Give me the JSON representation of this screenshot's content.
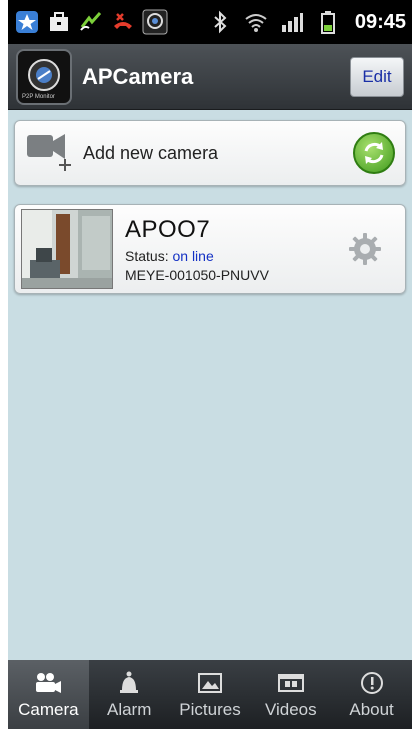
{
  "status_bar": {
    "time": "09:45",
    "icons": [
      "app-badge-icon",
      "briefcase-icon",
      "missed-call-icon",
      "call-end-icon",
      "camera-app-icon",
      "bluetooth-icon",
      "wifi-icon",
      "signal-icon",
      "battery-icon"
    ]
  },
  "header": {
    "title": "APCamera",
    "edit_label": "Edit",
    "logo_caption": "P2P Monitor"
  },
  "add_camera": {
    "label": "Add new camera"
  },
  "cameras": [
    {
      "name": "APOO7",
      "status_label": "Status:",
      "status_value": "on line",
      "device_id": "MEYE-001050-PNUVV"
    }
  ],
  "tabs": [
    {
      "label": "Camera",
      "icon": "camera-tab-icon",
      "active": true
    },
    {
      "label": "Alarm",
      "icon": "alarm-bell-icon",
      "active": false
    },
    {
      "label": "Pictures",
      "icon": "pictures-icon",
      "active": false
    },
    {
      "label": "Videos",
      "icon": "videos-icon",
      "active": false
    },
    {
      "label": "About",
      "icon": "about-icon",
      "active": false
    }
  ],
  "colors": {
    "background": "#c9dde3",
    "status_online": "#1330c4",
    "edit_text": "#1a2fa6",
    "refresh_green": "#3f9a1c"
  }
}
